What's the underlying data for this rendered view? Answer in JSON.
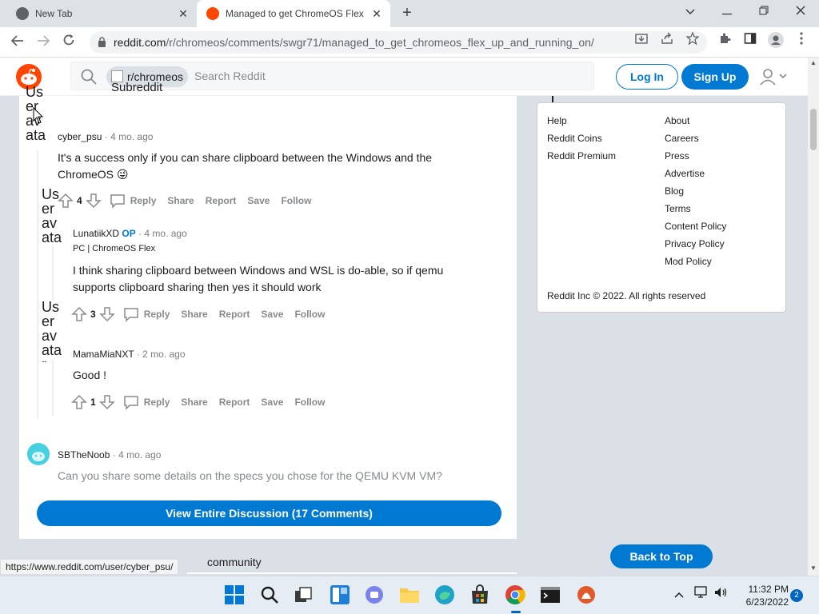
{
  "browser": {
    "tabs": [
      {
        "title": "New Tab",
        "active": false
      },
      {
        "title": "Managed to get ChromeOS Flex",
        "active": true
      }
    ],
    "url_host": "reddit.com",
    "url_path": "/r/chromeos/comments/swgr71/managed_to_get_chromeos_flex_up_and_running_on/",
    "new_tab_symbol": "+",
    "close_symbol": "✕"
  },
  "reddit_header": {
    "subreddit": "r/chromeos",
    "subreddit_icon_alt": "Subreddit Icon",
    "search_placeholder": "Search Reddit",
    "login_label": "Log In",
    "signup_label": "Sign Up"
  },
  "avatar_alt": "User avatar",
  "comments": [
    {
      "author": "cyber_psu",
      "time": "4 mo. ago",
      "body": "It's a success only if you can share clipboard between the Windows and the ChromeOS 😜",
      "score": "4"
    },
    {
      "author": "LunatiikXD",
      "op": "OP",
      "time": "4 mo. ago",
      "flair": "PC | ChromeOS Flex",
      "body": "I think sharing clipboard between Windows and WSL is do-able, so if qemu supports clipboard sharing then yes it should work",
      "score": "3"
    },
    {
      "author": "MamaMiaNXT",
      "time": "2 mo. ago",
      "body": "Good !",
      "score": "1"
    },
    {
      "author": "SBTheNoob",
      "time": "4 mo. ago",
      "body": "Can you share some details on the specs you chose for the QEMU KVM VM?"
    }
  ],
  "actions": {
    "reply": "Reply",
    "share": "Share",
    "report": "Report",
    "save": "Save",
    "follow": "Follow"
  },
  "separator": "·",
  "view_entire_label": "View Entire Discussion (17 Comments)",
  "sidebar": {
    "col1": [
      "Help",
      "Reddit Coins",
      "Reddit Premium"
    ],
    "col2": [
      "About",
      "Careers",
      "Press",
      "Advertise",
      "Blog",
      "Terms",
      "Content Policy",
      "Privacy Policy",
      "Mod Policy"
    ],
    "copyright": "Reddit Inc © 2022. All rights reserved"
  },
  "back_to_top": "Back to Top",
  "bottom_partial_text": "community",
  "status_url": "https://www.reddit.com/user/cyber_psu/",
  "taskbar": {
    "time": "11:32 PM",
    "date": "6/23/2022",
    "notification_count": "2"
  },
  "colors": {
    "reddit_blue": "#0079d3",
    "reddit_orange": "#ff4500",
    "page_bg": "#dae0e6"
  }
}
